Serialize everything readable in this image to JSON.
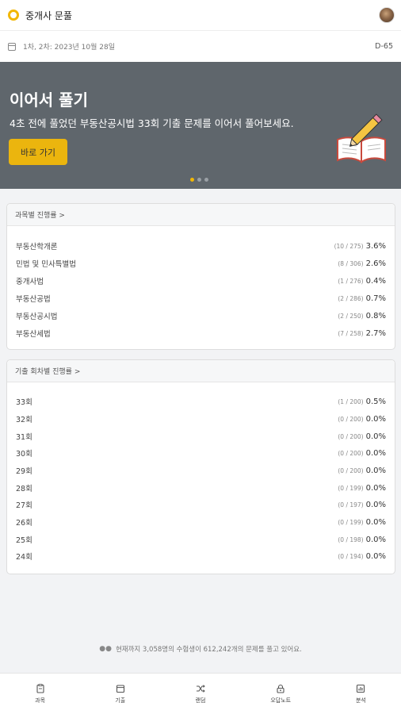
{
  "header": {
    "app_title": "중개사 문풀"
  },
  "exam_bar": {
    "date": "1차, 2차: 2023년 10월 28일",
    "dday": "D-65"
  },
  "banner": {
    "title": "이어서 풀기",
    "subtitle": "4초 전에 풀었던 부동산공시법 33회 기출 문제를 이어서 풀어보세요.",
    "button_label": "바로 가기",
    "page_count": 3,
    "active_page": 1
  },
  "subject_progress": {
    "header": "과목별 진행률 >",
    "rows": [
      {
        "label": "부동산학개론",
        "count": "(10 / 275)",
        "percent": "3.6%"
      },
      {
        "label": "민법 및 민사특별법",
        "count": "(8 / 306)",
        "percent": "2.6%"
      },
      {
        "label": "중개사법",
        "count": "(1 / 276)",
        "percent": "0.4%"
      },
      {
        "label": "부동산공법",
        "count": "(2 / 286)",
        "percent": "0.7%"
      },
      {
        "label": "부동산공시법",
        "count": "(2 / 250)",
        "percent": "0.8%"
      },
      {
        "label": "부동산세법",
        "count": "(7 / 258)",
        "percent": "2.7%"
      }
    ]
  },
  "round_progress": {
    "header": "기출 회차별 진행률 >",
    "rows": [
      {
        "label": "33회",
        "count": "(1 / 200)",
        "percent": "0.5%"
      },
      {
        "label": "32회",
        "count": "(0 / 200)",
        "percent": "0.0%"
      },
      {
        "label": "31회",
        "count": "(0 / 200)",
        "percent": "0.0%"
      },
      {
        "label": "30회",
        "count": "(0 / 200)",
        "percent": "0.0%"
      },
      {
        "label": "29회",
        "count": "(0 / 200)",
        "percent": "0.0%"
      },
      {
        "label": "28회",
        "count": "(0 / 199)",
        "percent": "0.0%"
      },
      {
        "label": "27회",
        "count": "(0 / 197)",
        "percent": "0.0%"
      },
      {
        "label": "26회",
        "count": "(0 / 199)",
        "percent": "0.0%"
      },
      {
        "label": "25회",
        "count": "(0 / 198)",
        "percent": "0.0%"
      },
      {
        "label": "24회",
        "count": "(0 / 194)",
        "percent": "0.0%"
      }
    ]
  },
  "notice": "현재까지 3,058명의 수험생이 612,242개의 문제를 풀고 있어요.",
  "tabbar": [
    {
      "label": "과목",
      "icon": "clipboard-icon"
    },
    {
      "label": "기출",
      "icon": "calendar-icon"
    },
    {
      "label": "랜덤",
      "icon": "shuffle-icon"
    },
    {
      "label": "오답노트",
      "icon": "lock-icon"
    },
    {
      "label": "분석",
      "icon": "bar-chart-icon"
    }
  ],
  "colors": {
    "accent": "#f2b705",
    "banner_bg": "#5f666c",
    "button": "#ebb50e"
  }
}
